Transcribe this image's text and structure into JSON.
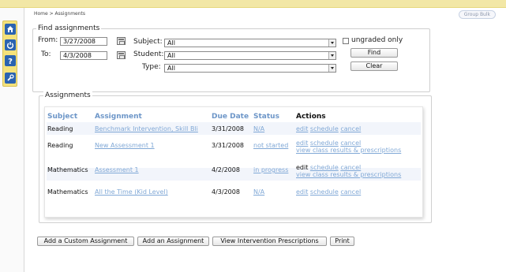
{
  "breadcrumb": "Home > Assignments",
  "group_button": "Group Bulk",
  "find": {
    "legend": "Find assignments",
    "from_label": "From:",
    "from_value": "3/27/2008",
    "to_label": "To:",
    "to_value": "4/3/2008",
    "subject_label": "Subject:",
    "subject_value": "All",
    "student_label": "Student:",
    "student_value": "All",
    "type_label": "Type:",
    "type_value": "All",
    "ungraded_label": "ungraded only",
    "find_button": "Find",
    "clear_button": "Clear"
  },
  "assignments": {
    "legend": "Assignments",
    "headers": {
      "subject": "Subject",
      "assignment": "Assignment",
      "due": "Due Date",
      "status": "Status",
      "actions": "Actions"
    },
    "rows": [
      {
        "subject": "Reading",
        "assignment": "Benchmark Intervention, Skill Bli",
        "due": "3/31/2008",
        "status": "N/A",
        "action_lines": [
          [
            "edit",
            "schedule",
            "cancel"
          ]
        ]
      },
      {
        "subject": "Reading",
        "assignment": "New Assessment 1",
        "due": "3/31/2008",
        "status": "not started",
        "action_lines": [
          [
            "edit",
            "schedule",
            "cancel"
          ],
          [
            "view class results & prescriptions"
          ]
        ]
      },
      {
        "subject": "Mathematics",
        "assignment": "Assessment 1",
        "due": "4/2/2008",
        "status": "in progress",
        "action_lines": [
          [
            "edit",
            "schedule",
            "cancel"
          ],
          [
            "view class results & prescriptions"
          ]
        ]
      },
      {
        "subject": "Mathematics",
        "assignment": "All the Time (Kid Level)",
        "due": "4/3/2008",
        "status": "N/A",
        "action_lines": [
          [
            "edit",
            "schedule",
            "cancel"
          ]
        ]
      }
    ]
  },
  "bottom_buttons": {
    "add_custom": "Add a Custom Assignment",
    "add_assignment": "Add an Assignment",
    "view_prescriptions": "View Intervention Prescriptions",
    "print": "Print"
  },
  "icons": {
    "toolbar": [
      "home-icon",
      "power-icon",
      "help-icon",
      "tools-icon"
    ],
    "accent": "#2b63b0",
    "link_color": "#80a8d6",
    "header_color": "#6d96c8"
  }
}
